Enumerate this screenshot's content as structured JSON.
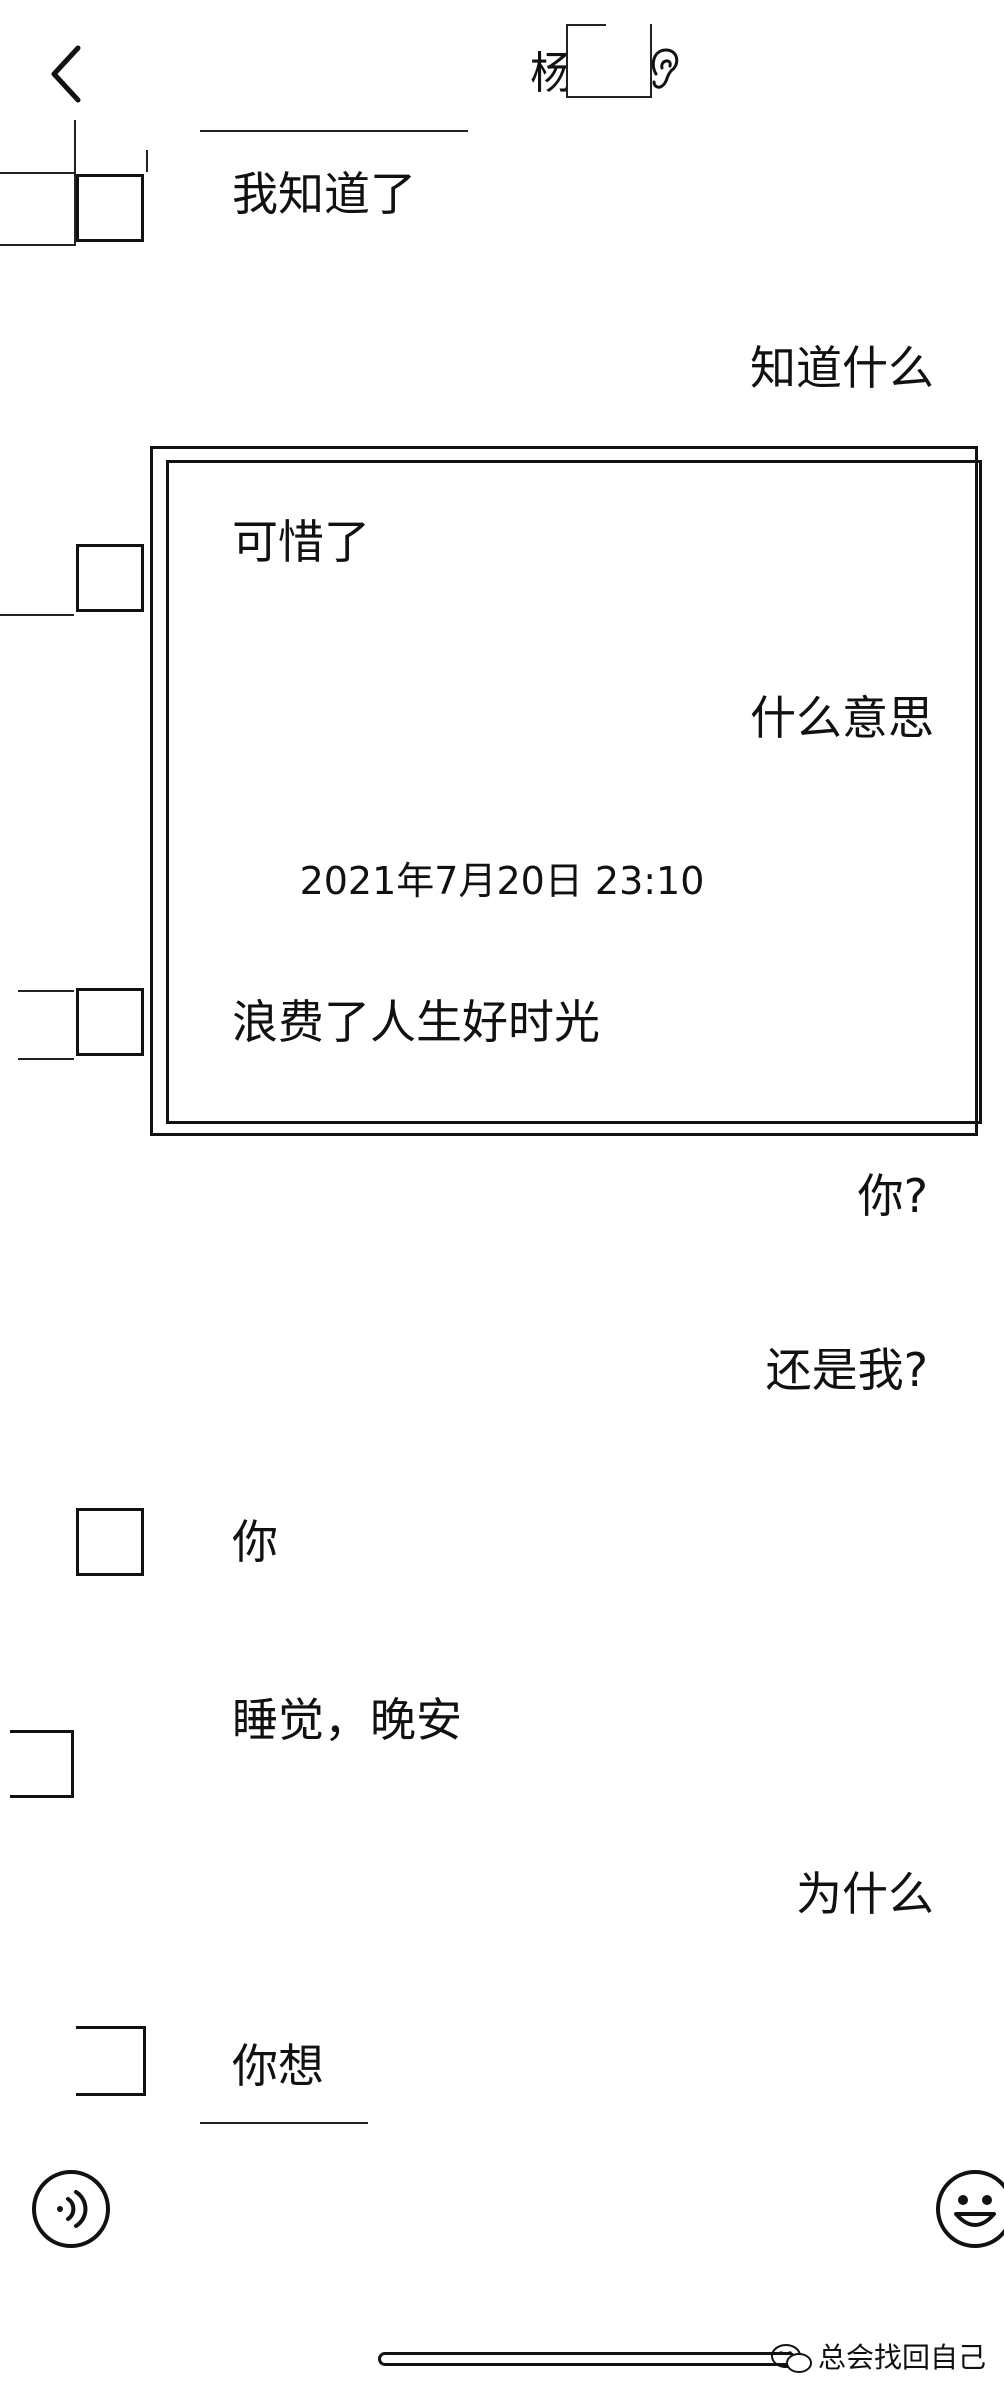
{
  "header": {
    "title": "杨"
  },
  "messages": [
    {
      "side": "left",
      "text": "我知道了"
    },
    {
      "side": "right",
      "text": "知道什么"
    },
    {
      "side": "left",
      "text": "可惜了"
    },
    {
      "side": "right",
      "text": "什么意思"
    },
    {
      "side": "left",
      "text": "浪费了人生好时光"
    },
    {
      "side": "right",
      "text": "你?"
    },
    {
      "side": "right",
      "text": "还是我?"
    },
    {
      "side": "left",
      "text": "你"
    },
    {
      "side": "left",
      "text": "睡觉，晚安"
    },
    {
      "side": "right",
      "text": "为什么"
    },
    {
      "side": "left",
      "text": "你想"
    }
  ],
  "timestamp": "2021年7月20日 23:10",
  "watermark": "总会找回自己",
  "icons": {
    "back": "chevron-left-icon",
    "ear": "ear-icon",
    "voice": "voice-icon",
    "emoji": "emoji-icon",
    "watermark": "wechat-icon"
  }
}
